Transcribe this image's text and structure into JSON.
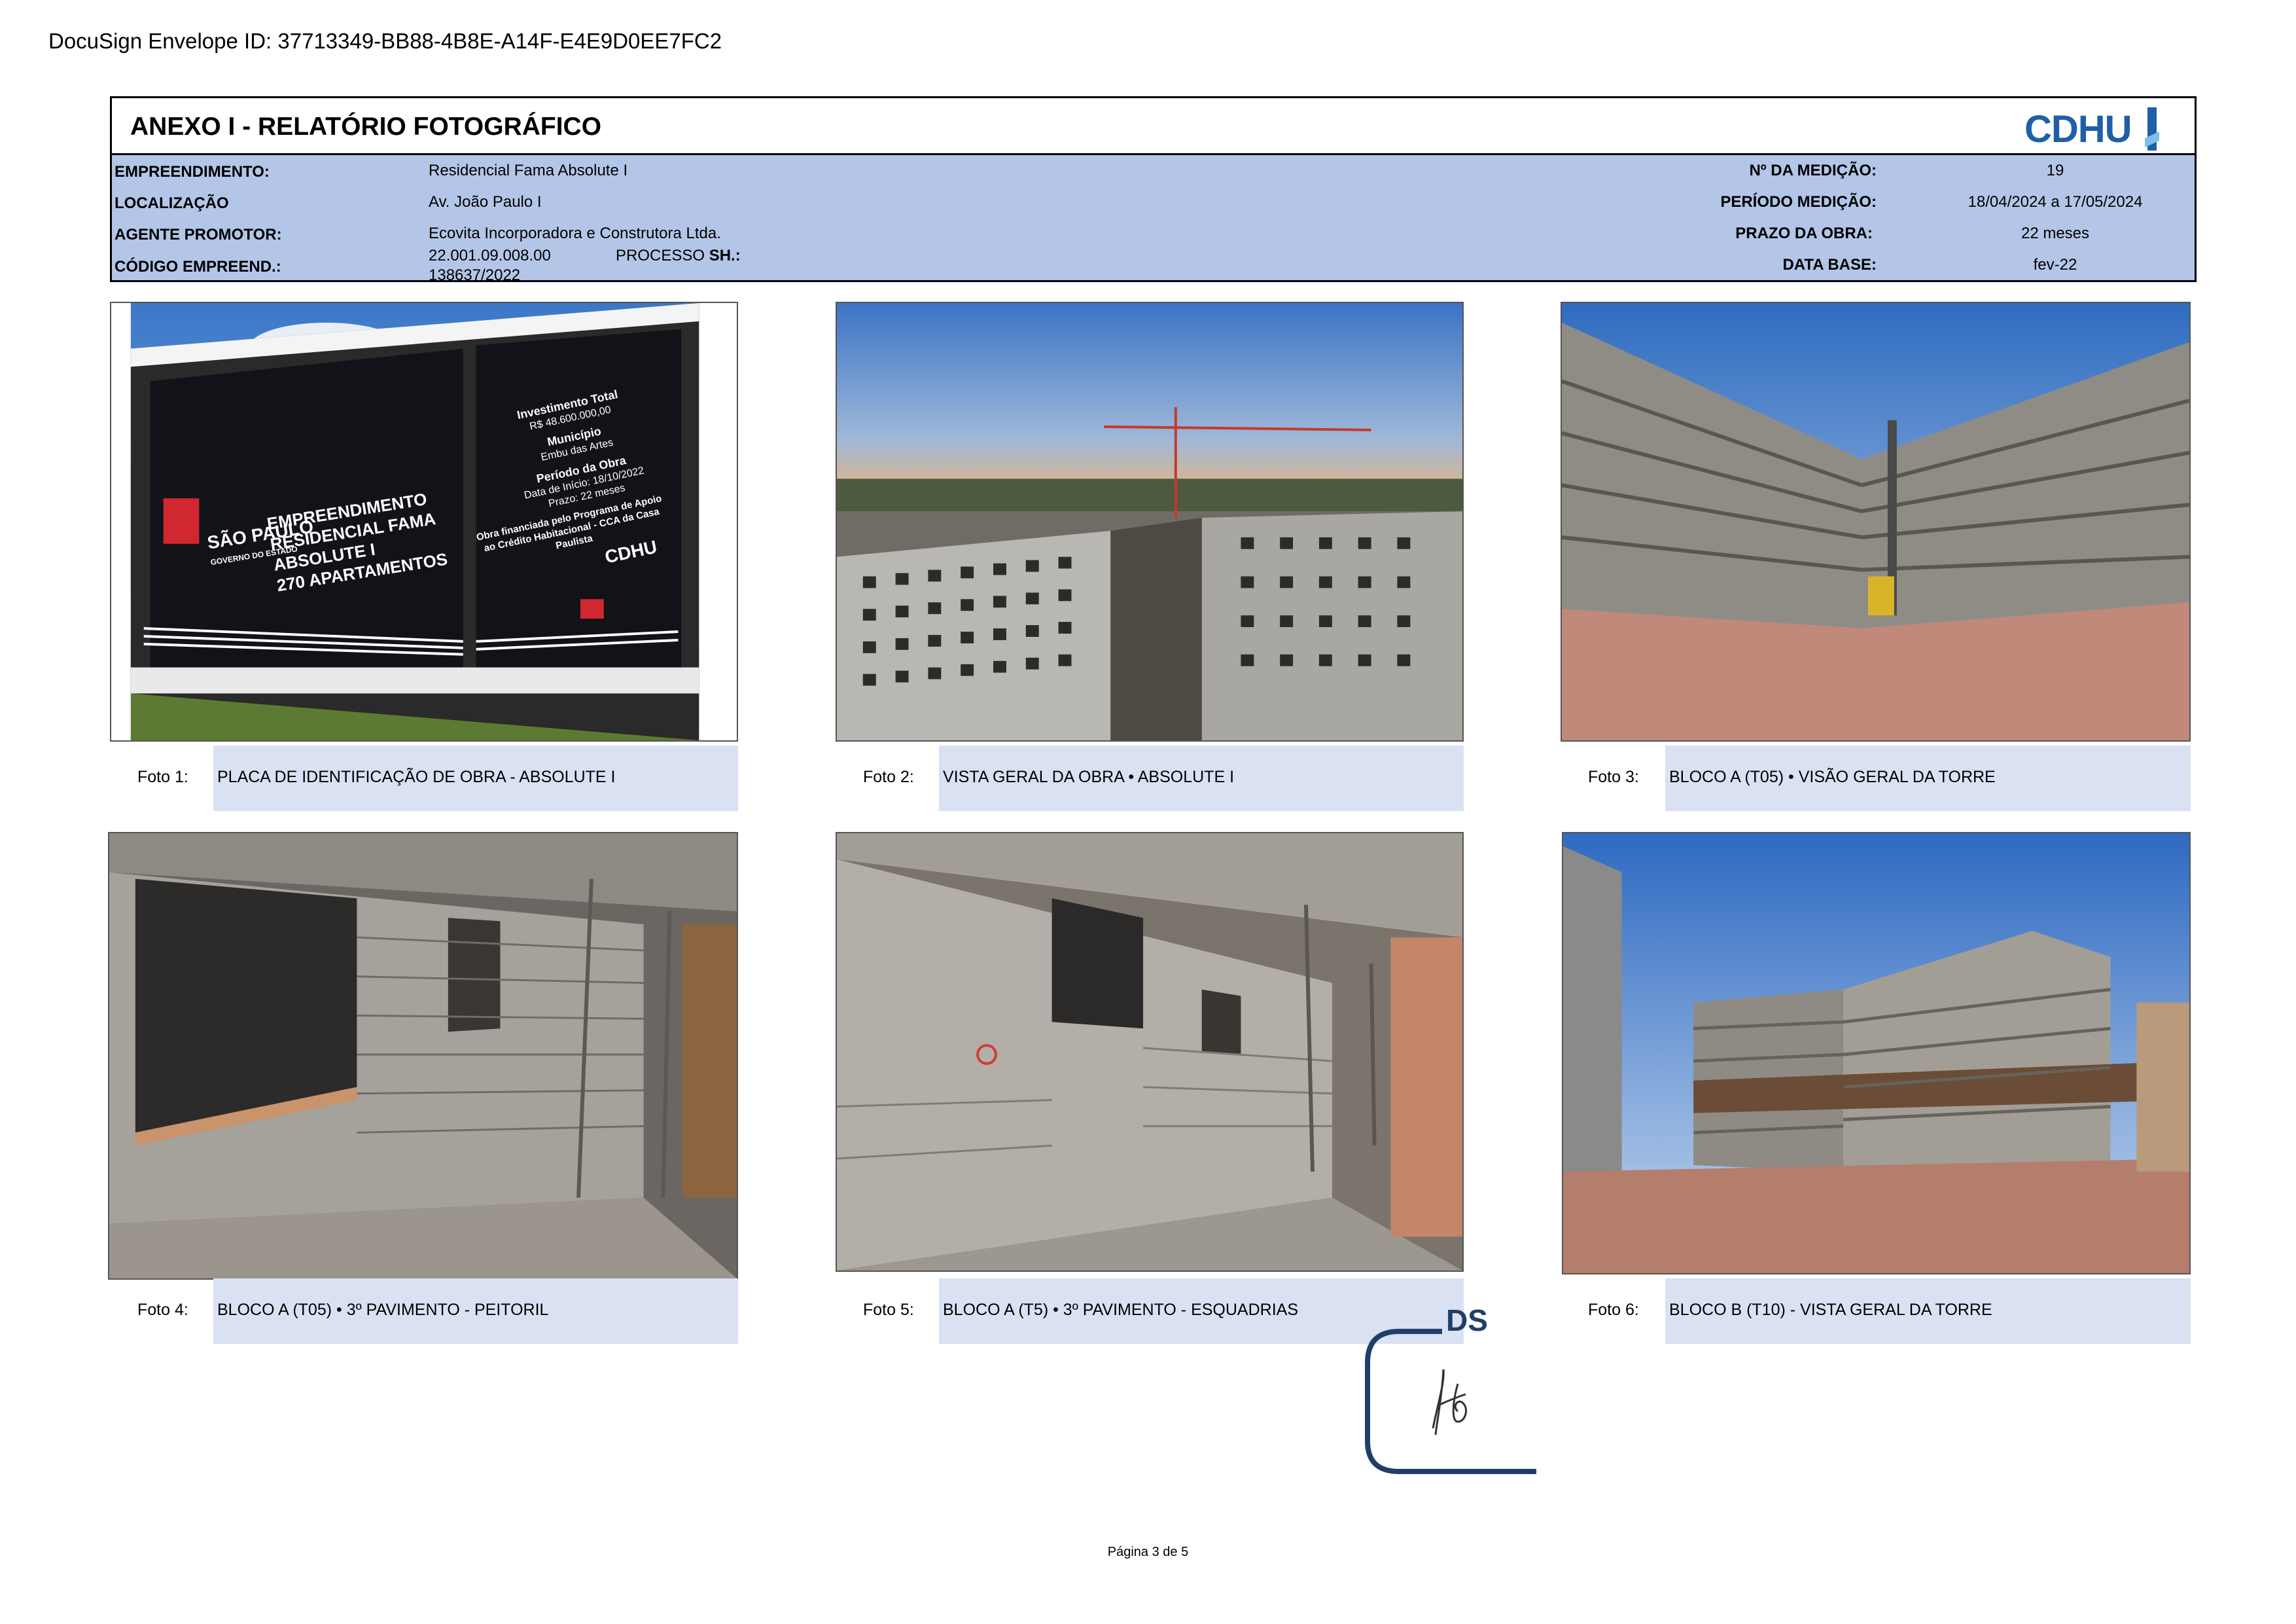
{
  "envelope": "DocuSign Envelope ID: 37713349-BB88-4B8E-A14F-E4E9D0EE7FC2",
  "header": {
    "title": "ANEXO I - RELATÓRIO FOTOGRÁFICO",
    "logo": "CDHU"
  },
  "info": {
    "empreendimento_label": "EMPREENDIMENTO:",
    "empreendimento_value": "Residencial Fama Absolute I",
    "localizacao_label": "LOCALIZAÇÃO",
    "localizacao_value": "Av. João Paulo I",
    "agente_label": "AGENTE PROMOTOR:",
    "agente_value": "Ecovita Incorporadora e Construtora Ltda.",
    "codigo_label": "CÓDIGO EMPREEND.:",
    "codigo_value": "22.001.09.008.00",
    "processo_label": "PROCESSO",
    "processo_sh": "SH.:",
    "processo_value": "138637/2022",
    "medicao_label": "Nº DA MEDIÇÃO:",
    "medicao_value": "19",
    "periodo_label": "PERÍODO MEDIÇÃO:",
    "periodo_value": "18/04/2024 a 17/05/2024",
    "prazo_label": "PRAZO DA OBRA:",
    "prazo_value": "22 meses",
    "database_label": "DATA BASE:",
    "database_value": "fev-22"
  },
  "sign_board": {
    "investimento_label": "Investimento Total",
    "investimento_value": "R$ 48.600.000,00",
    "municipio_label": "Município",
    "municipio_value": "Embu das Artes",
    "periodo_label": "Período da Obra",
    "periodo_inicio": "Data de Início: 18/10/2022",
    "periodo_prazo": "Prazo: 22 meses",
    "line1": "EMPREENDIMENTO",
    "line2": "RESIDENCIAL FAMA",
    "line3": "ABSOLUTE I",
    "line4": "270 APARTAMENTOS",
    "sp_name": "SÃO PAULO",
    "sp_sub": "GOVERNO DO ESTADO",
    "financiada": "Obra financiada pelo Programa de Apoio ao Crédito Habitacional - CCA da Casa Paulista",
    "cdhu": "CDHU"
  },
  "photos": [
    {
      "num": "Foto 1:",
      "caption": "PLACA DE IDENTIFICAÇÃO DE OBRA - ABSOLUTE I"
    },
    {
      "num": "Foto 2:",
      "caption": "VISTA GERAL DA OBRA • ABSOLUTE I"
    },
    {
      "num": "Foto 3:",
      "caption": "BLOCO A (T05) •  VISÃO GERAL DA TORRE"
    },
    {
      "num": "Foto 4:",
      "caption": "BLOCO A (T05) • 3º PAVIMENTO - PEITORIL"
    },
    {
      "num": "Foto 5:",
      "caption": "BLOCO A (T5) • 3º PAVIMENTO  - ESQUADRIAS"
    },
    {
      "num": "Foto 6:",
      "caption": "BLOCO B (T10) - VISTA GERAL DA TORRE"
    }
  ],
  "signature": {
    "ds": "DS"
  },
  "footer": "Página 3 de 5"
}
